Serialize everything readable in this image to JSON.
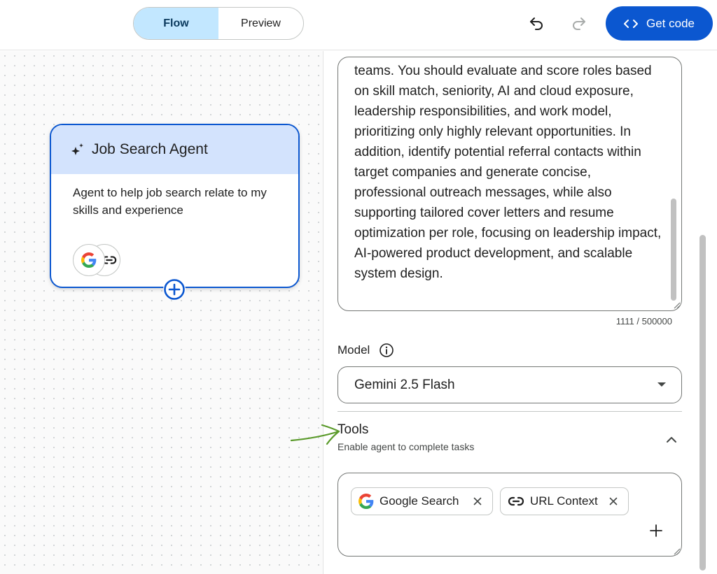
{
  "topbar": {
    "tabs": [
      {
        "label": "Flow",
        "active": true
      },
      {
        "label": "Preview",
        "active": false
      }
    ],
    "get_code_label": "Get code"
  },
  "node": {
    "title": "Job Search Agent",
    "description": "Agent to help job search relate to my skills and experience",
    "tool_icons": [
      "google-icon",
      "link-icon"
    ]
  },
  "panel": {
    "instructions_text": "teams. You should evaluate and score roles based on skill match, seniority, AI and cloud exposure, leadership responsibilities, and work model, prioritizing only highly relevant opportunities. In addition, identify potential referral contacts within target companies and generate concise, professional outreach messages, while also supporting tailored cover letters and resume optimization per role, focusing on leadership impact, AI-powered product development, and scalable system design.",
    "char_counter": "1111 / 500000",
    "model_label": "Model",
    "model_value": "Gemini 2.5 Flash",
    "tools_title": "Tools",
    "tools_subtitle": "Enable agent to complete tasks",
    "tools": [
      {
        "label": "Google Search",
        "icon": "google-icon"
      },
      {
        "label": "URL Context",
        "icon": "link-icon"
      }
    ]
  },
  "colors": {
    "accent": "#0b57d0",
    "active_tab_bg": "#c2e7ff",
    "node_header_bg": "#d3e3fd",
    "annotation_arrow": "#5a9a2a"
  }
}
